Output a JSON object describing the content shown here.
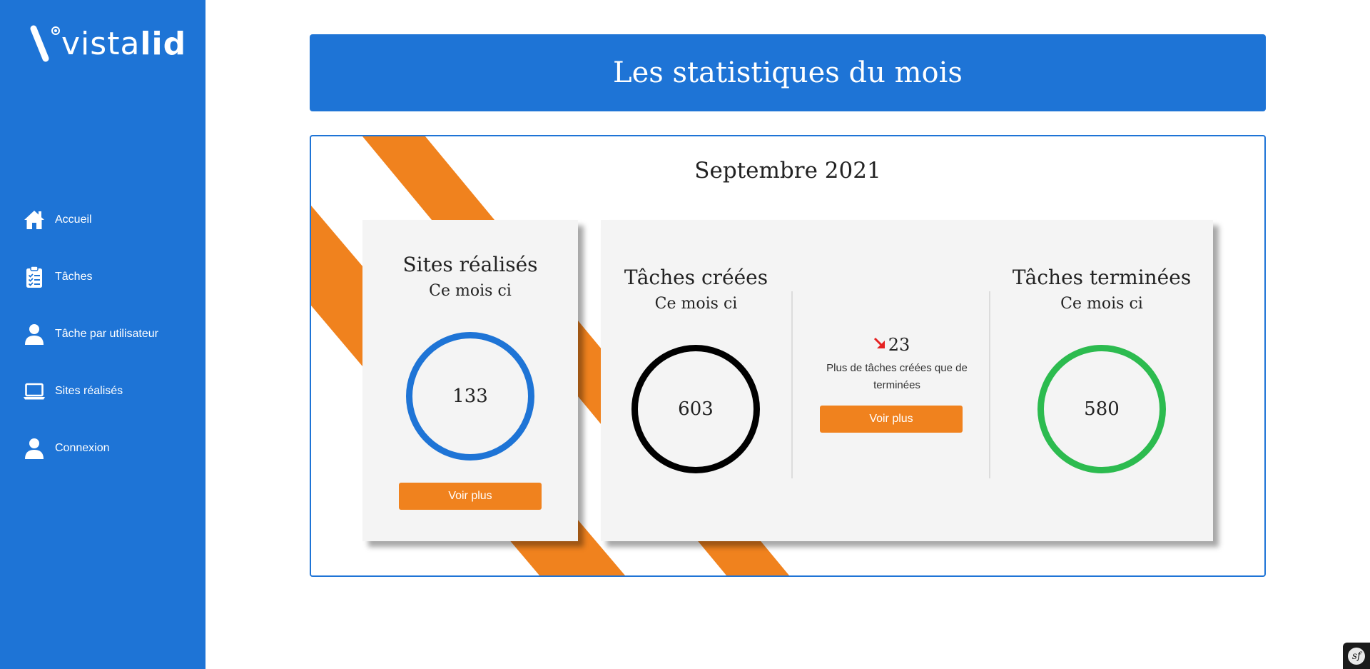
{
  "brand": {
    "name_thin": "vista",
    "name_bold": "lid"
  },
  "colors": {
    "primary": "#1e74d6",
    "accent": "#f0821e",
    "success": "#2cbb4f",
    "danger": "#e52222",
    "card": "#f4f4f4"
  },
  "sidebar": {
    "items": [
      {
        "label": "Accueil",
        "icon": "home-icon"
      },
      {
        "label": "Tâches",
        "icon": "clipboard-list-icon"
      },
      {
        "label": "Tâche par utilisateur",
        "icon": "user-icon"
      },
      {
        "label": "Sites réalisés",
        "icon": "laptop-icon"
      },
      {
        "label": "Connexion",
        "icon": "user-icon"
      }
    ]
  },
  "header": {
    "title": "Les statistiques du mois"
  },
  "period": {
    "label": "Septembre 2021"
  },
  "sites": {
    "title": "Sites réalisés",
    "subtitle": "Ce mois ci",
    "value": "133",
    "button": "Voir plus"
  },
  "created": {
    "title": "Tâches créées",
    "subtitle": "Ce mois ci",
    "value": "603"
  },
  "difference": {
    "value": "23",
    "trend": "down",
    "description": "Plus de tâches créées que de terminées",
    "button": "Voir plus"
  },
  "finished": {
    "title": "Tâches terminées",
    "subtitle": "Ce mois ci",
    "value": "580"
  },
  "debug_toolbar": {
    "icon": "symfony-icon",
    "label": "sf"
  }
}
